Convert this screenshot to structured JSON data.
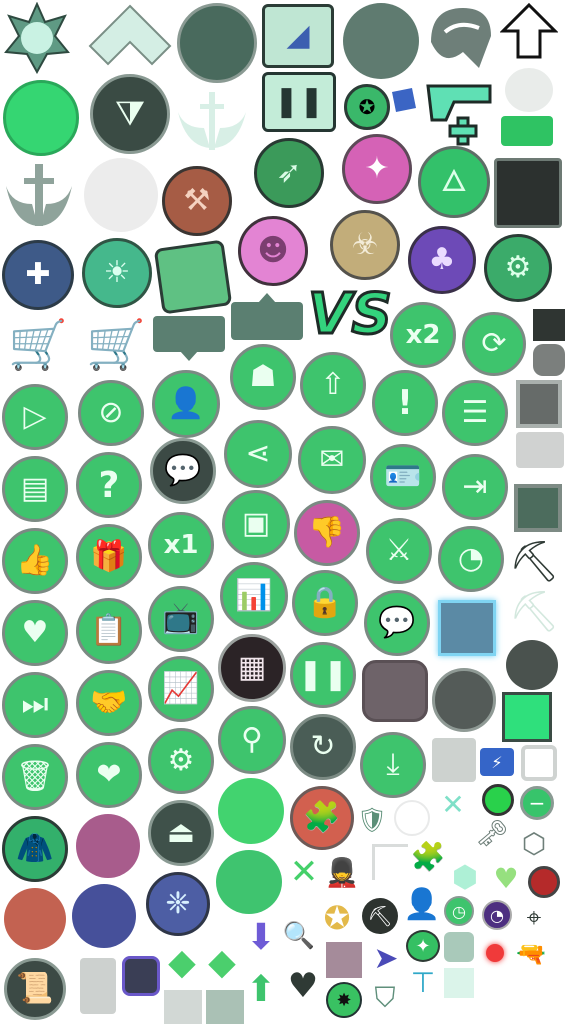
{
  "icons": {
    "sheriff_star": "sheriff-star-icon",
    "rank_chevron": "rank-chevron-icon",
    "clipboard_map": "clipboard-map-icon",
    "helmet": "helmet-icon",
    "arrow_up": "arrow-up-icon",
    "filter": "filter-icon",
    "sword_wings": "sword-wings-icon",
    "clipboard_pause": "clipboard-pause-icon",
    "gun_plus": "gun-plus-icon",
    "bow": "bow-icon",
    "magic_star": "magic-star-icon",
    "fire": "fire-icon",
    "heal_wings": "heal-wings-icon",
    "sun_gear": "sun-gear-icon",
    "notebook": "notebook-icon",
    "demon": "demon-icon",
    "biohazard": "biohazard-icon",
    "tree": "tree-icon",
    "hammer_totem": "hammer-totem-icon",
    "cart_star": "cart-star-icon",
    "play": "play-icon",
    "block": "block-icon",
    "person_plus": "person-plus-icon",
    "muscle": "muscle-icon",
    "upgrade": "upgrade-icon",
    "exclamation": "exclamation-icon",
    "list": "list-icon",
    "book": "book-icon",
    "question": "question-icon",
    "chat": "chat-icon",
    "share": "share-icon",
    "mail": "mail-icon",
    "id_card": "id-card-icon",
    "exit": "exit-icon",
    "thumb_up": "thumb-up-icon",
    "gift": "gift-icon",
    "chest": "chest-icon",
    "thumb_down": "thumb-down-icon",
    "swords": "crossed-swords-icon",
    "pie": "pie-chart-icon",
    "pickaxe": "pickaxe-icon",
    "heart": "heart-icon",
    "clipboard": "clipboard-icon",
    "tv": "tv-icon",
    "bars": "bar-chart-icon",
    "lock": "lock-icon",
    "grid": "grid-icon",
    "skip": "skip-icon",
    "handshake": "handshake-icon",
    "line_chart": "line-chart-icon",
    "pause": "pause-icon",
    "trash": "trash-icon",
    "heart_share": "heart-share-icon",
    "gear": "gear-icon",
    "restart": "restart-icon",
    "download": "download-icon",
    "jacket": "jacket-icon",
    "eject": "eject-icon",
    "puzzle": "puzzle-icon",
    "refresh": "refresh-icon",
    "crystal": "crystal-icon",
    "key": "key-icon",
    "stopwatch": "stopwatch-icon",
    "crosshair": "crosshair-icon",
    "magnifier": "magnifier-icon"
  },
  "labels": {
    "vs": "VS",
    "x2": "x2",
    "x1": "x1",
    "question": "?",
    "exclamation": "!"
  }
}
